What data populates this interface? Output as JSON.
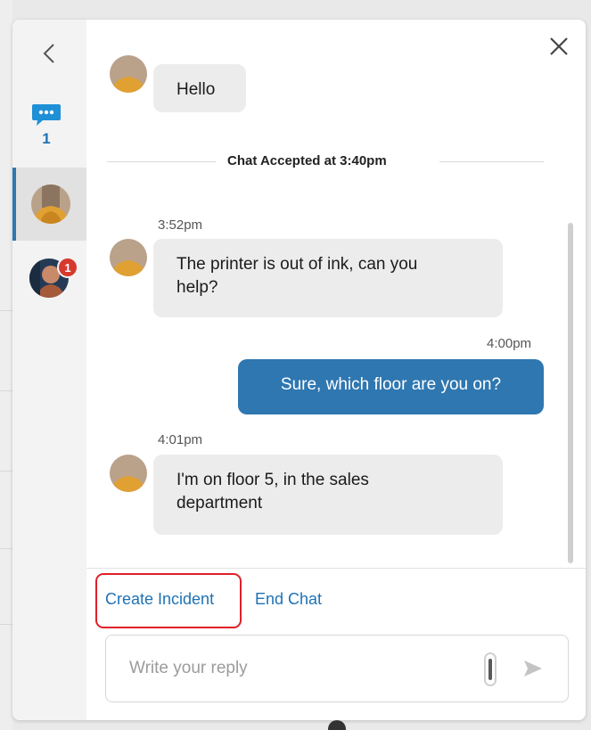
{
  "rail": {
    "unread_chats_count": "1",
    "conversations": [
      {
        "name": "customer-avatar",
        "active": true
      },
      {
        "name": "agent-avatar",
        "unread_badge": "1"
      }
    ]
  },
  "messages": [
    {
      "id": "m1",
      "direction": "incoming",
      "text": "Hello"
    },
    {
      "id": "m2",
      "direction": "incoming",
      "time": "3:52pm",
      "text_line1": "The printer is out of ink, can you",
      "text_line2": "help?"
    },
    {
      "id": "m3",
      "direction": "outgoing",
      "time": "4:00pm",
      "text": "Sure, which floor are you on?"
    },
    {
      "id": "m4",
      "direction": "incoming",
      "time": "4:01pm",
      "text_line1": "I'm on floor 5, in the sales",
      "text_line2": "department"
    }
  ],
  "divider": {
    "text": "Chat Accepted at 3:40pm"
  },
  "actions": {
    "create_incident": "Create Incident",
    "end_chat": "End Chat"
  },
  "reply": {
    "placeholder": "Write your reply",
    "value": ""
  },
  "colors": {
    "accent": "#2f77b0",
    "link": "#1f72b4",
    "highlight": "#e0202a",
    "incoming_bubble": "#ececec",
    "badge": "#d63a2e"
  },
  "icons": [
    "chevron-left-icon",
    "chat-bubble-icon",
    "close-icon",
    "attachment-icon",
    "send-icon"
  ]
}
